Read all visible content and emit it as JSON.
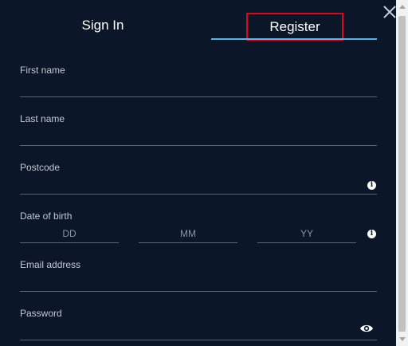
{
  "tabs": {
    "signin_label": "Sign In",
    "register_label": "Register"
  },
  "form": {
    "first_name_label": "First name",
    "last_name_label": "Last name",
    "postcode_label": "Postcode",
    "dob_label": "Date of birth",
    "dob_dd_placeholder": "DD",
    "dob_mm_placeholder": "MM",
    "dob_yy_placeholder": "YY",
    "email_label": "Email address",
    "password_label": "Password"
  },
  "icons": {
    "close": "close-icon",
    "info": "info-icon",
    "eye": "eye-icon",
    "info_glyph": "i"
  },
  "colors": {
    "background": "#0c1629",
    "accent_underline": "#53b7ea",
    "highlight_border": "#e0061a"
  }
}
